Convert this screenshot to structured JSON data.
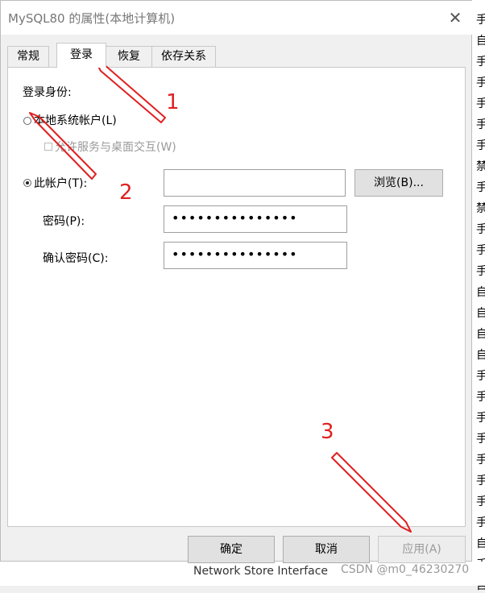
{
  "window": {
    "title": "MySQL80 的属性(本地计算机)",
    "close_glyph": "✕"
  },
  "tabs": [
    {
      "label": "常规"
    },
    {
      "label": "登录"
    },
    {
      "label": "恢复"
    },
    {
      "label": "依存关系"
    }
  ],
  "logon": {
    "section_label": "登录身份:",
    "local_system_label": "本地系统帐户(L)",
    "allow_desktop_label": "允许服务与桌面交互(W)",
    "this_account_label": "此帐户(T):",
    "account_value": "",
    "browse_label": "浏览(B)...",
    "password_label": "密码(P):",
    "password_value": "•••••••••••••••",
    "confirm_label": "确认密码(C):",
    "confirm_value": "•••••••••••••••"
  },
  "footer": {
    "ok_label": "确定",
    "cancel_label": "取消",
    "apply_label": "应用(A)"
  },
  "background": {
    "right_column": [
      "手",
      "自",
      "手",
      "手",
      "手",
      "手",
      "手",
      "禁",
      "手",
      "禁",
      "手",
      "手",
      "手",
      "自",
      "自",
      "自",
      "自",
      "手",
      "手",
      "手",
      "手",
      "手",
      "手",
      "手",
      "手",
      "自",
      "手",
      "自"
    ],
    "bottom_text": "Network Store Interface"
  },
  "annotations": [
    "1",
    "2",
    "3"
  ],
  "watermark": "CSDN @m0_46230270",
  "colors": {
    "annotation": "#e02020"
  }
}
